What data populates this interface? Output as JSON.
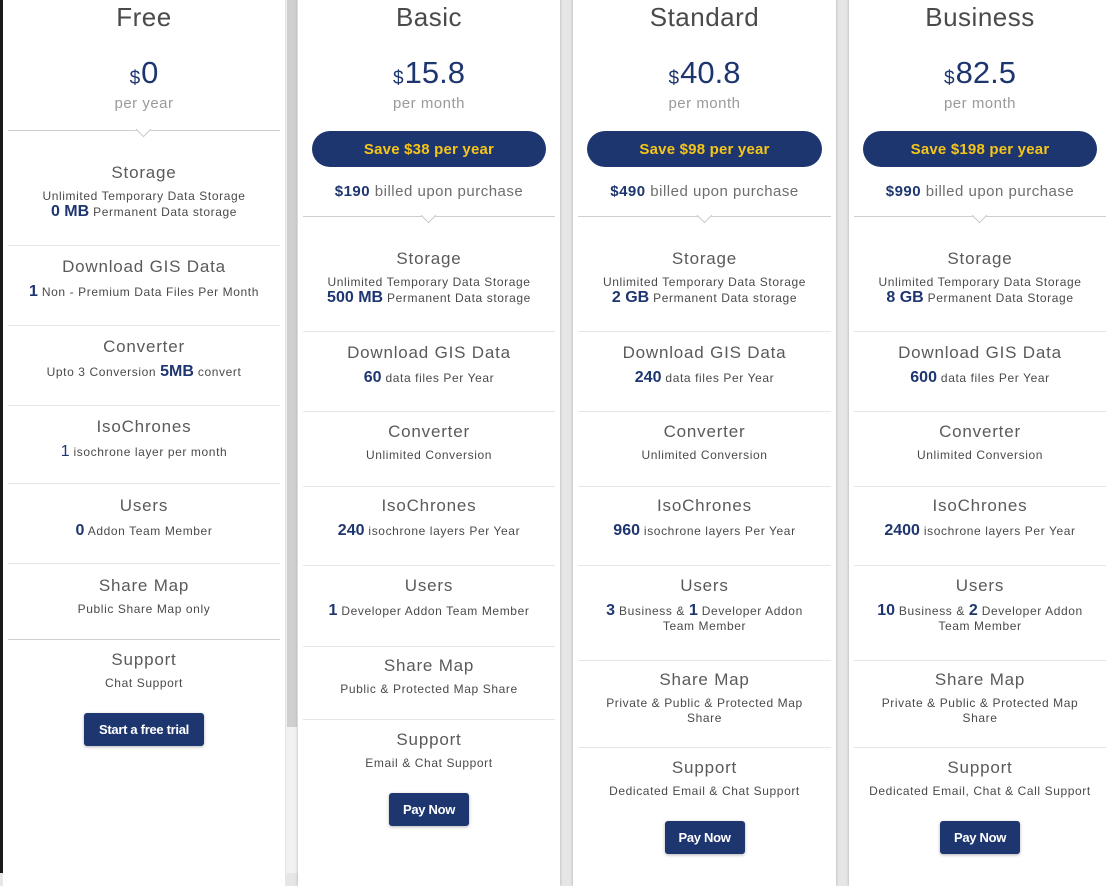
{
  "plans": [
    {
      "name": "Free",
      "currency": "$",
      "price": "0",
      "period": "per year",
      "sections": [
        {
          "title": "Storage",
          "lines": [
            "Unlimited Temporary Data Storage"
          ],
          "highlight": "0 MB",
          "text": " Permanent Data storage"
        },
        {
          "title": "Download GIS Data",
          "highlight": "1",
          "text": " Non - Premium Data Files Per Month"
        },
        {
          "title": "Converter",
          "pre": "Upto 3 Conversion ",
          "highlight": "5MB",
          "text": " convert"
        },
        {
          "title": "IsoChrones",
          "highlight": "1",
          "text": " isochrone layer per month"
        },
        {
          "title": "Users",
          "highlight": "0",
          "text": " Addon Team Member"
        },
        {
          "title": "Share Map",
          "text": "Public Share Map only"
        },
        {
          "title": "Support",
          "text": "Chat Support"
        }
      ],
      "button": "Start a free trial"
    },
    {
      "name": "Basic",
      "currency": "$",
      "price": "15.8",
      "period": "per month",
      "save": "Save $38 per year",
      "billed_amount": "$190",
      "billed_text": " billed upon purchase",
      "sections": [
        {
          "title": "Storage",
          "lines": [
            "Unlimited Temporary Data Storage"
          ],
          "highlight": "500 MB",
          "text": " Permanent Data storage"
        },
        {
          "title": "Download GIS Data",
          "highlight": "60",
          "text": " data files Per Year"
        },
        {
          "title": "Converter",
          "text": "Unlimited Conversion"
        },
        {
          "title": "IsoChrones",
          "highlight": "240",
          "text": " isochrone layers Per Year"
        },
        {
          "title": "Users",
          "highlight": "1",
          "text": " Developer Addon Team Member"
        },
        {
          "title": "Share Map",
          "text": "Public & Protected Map Share"
        },
        {
          "title": "Support",
          "text": "Email & Chat Support"
        }
      ],
      "button": "Pay Now"
    },
    {
      "name": "Standard",
      "currency": "$",
      "price": "40.8",
      "period": "per month",
      "save": "Save $98 per year",
      "billed_amount": "$490",
      "billed_text": " billed upon purchase",
      "sections": [
        {
          "title": "Storage",
          "lines": [
            "Unlimited Temporary Data Storage"
          ],
          "highlight": "2 GB",
          "text": " Permanent Data storage"
        },
        {
          "title": "Download GIS Data",
          "highlight": "240",
          "text": " data files Per Year"
        },
        {
          "title": "Converter",
          "text": "Unlimited Conversion"
        },
        {
          "title": "IsoChrones",
          "highlight": "960",
          "text": " isochrone layers Per Year"
        },
        {
          "title": "Users",
          "highlight": "3",
          "text": " Business & ",
          "highlight2": "1",
          "text2": " Developer Addon Team Member"
        },
        {
          "title": "Share Map",
          "text": "Private & Public & Protected Map Share"
        },
        {
          "title": "Support",
          "text": "Dedicated Email & Chat Support"
        }
      ],
      "button": "Pay Now"
    },
    {
      "name": "Business",
      "currency": "$",
      "price": "82.5",
      "period": "per month",
      "save": "Save $198 per year",
      "billed_amount": "$990",
      "billed_text": " billed upon purchase",
      "sections": [
        {
          "title": "Storage",
          "lines": [
            "Unlimited Temporary Data Storage"
          ],
          "highlight": "8 GB",
          "text": " Permanent Data Storage"
        },
        {
          "title": "Download GIS Data",
          "highlight": "600",
          "text": " data files Per Year"
        },
        {
          "title": "Converter",
          "text": "Unlimited Conversion"
        },
        {
          "title": "IsoChrones",
          "highlight": "2400",
          "text": " isochrone layers Per Year"
        },
        {
          "title": "Users",
          "highlight": "10",
          "text": " Business & ",
          "highlight2": "2",
          "text2": " Developer Addon Team Member"
        },
        {
          "title": "Share Map",
          "text": "Private & Public & Protected Map Share"
        },
        {
          "title": "Support",
          "text": "Dedicated Email, Chat & Call Support"
        }
      ],
      "button": "Pay Now"
    }
  ],
  "colors": {
    "brand": "#1e3670",
    "accent": "#f5c518"
  }
}
